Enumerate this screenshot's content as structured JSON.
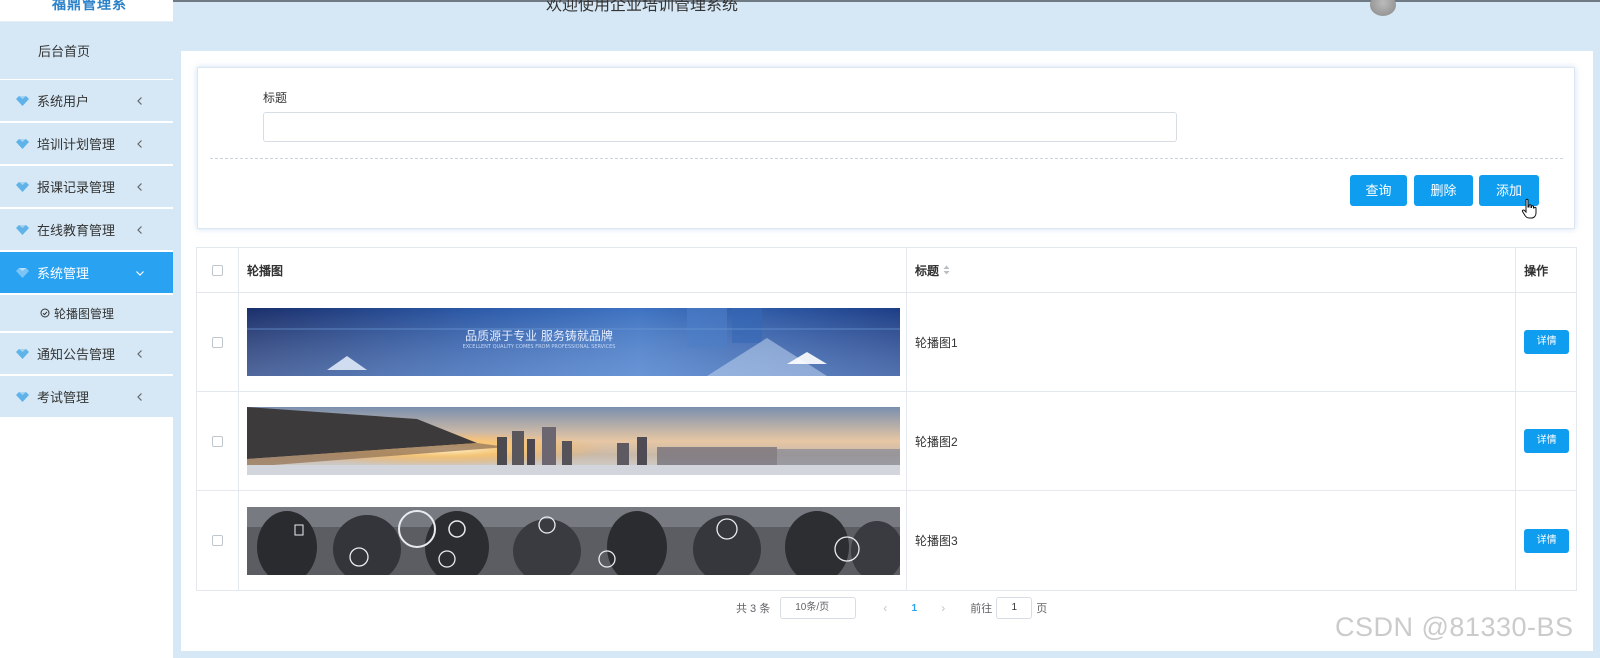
{
  "header": {
    "title": "欢迎使用企业培训管理系统",
    "brand_fragment": "福鼎管理系"
  },
  "sidebar": {
    "home_label": "后台首页",
    "items": [
      {
        "label": "系统用户"
      },
      {
        "label": "培训计划管理"
      },
      {
        "label": "报课记录管理"
      },
      {
        "label": "在线教育管理"
      },
      {
        "label": "系统管理"
      },
      {
        "label": "通知公告管理"
      },
      {
        "label": "考试管理"
      }
    ],
    "sub_item_label": "轮播图管理"
  },
  "search": {
    "field_label": "标题",
    "field_value": "",
    "placeholder": ""
  },
  "buttons": {
    "query": "查询",
    "delete": "删除",
    "add": "添加"
  },
  "table": {
    "headers": {
      "image": "轮播图",
      "title": "标题",
      "actions": "操作"
    },
    "rows": [
      {
        "title": "轮播图1",
        "action": "详情",
        "banner_text": "品质源于专业 服务铸就品牌",
        "banner_sub": "EXCELLENT QUALITY COMES FROM PROFESSIONAL SERVICES"
      },
      {
        "title": "轮播图2",
        "action": "详情"
      },
      {
        "title": "轮播图3",
        "action": "详情"
      }
    ]
  },
  "pagination": {
    "total": "共 3 条",
    "page_size": "10条/页",
    "current_page": "1",
    "goto_prefix": "前往",
    "goto_value": "1",
    "goto_suffix": "页"
  },
  "watermark": "CSDN @81330-BS",
  "colors": {
    "primary": "#0f9df0",
    "sidebar_active": "#2aa2f2",
    "sidebar_bg": "#d6e8f6",
    "page_bg": "#d6e8f6"
  }
}
